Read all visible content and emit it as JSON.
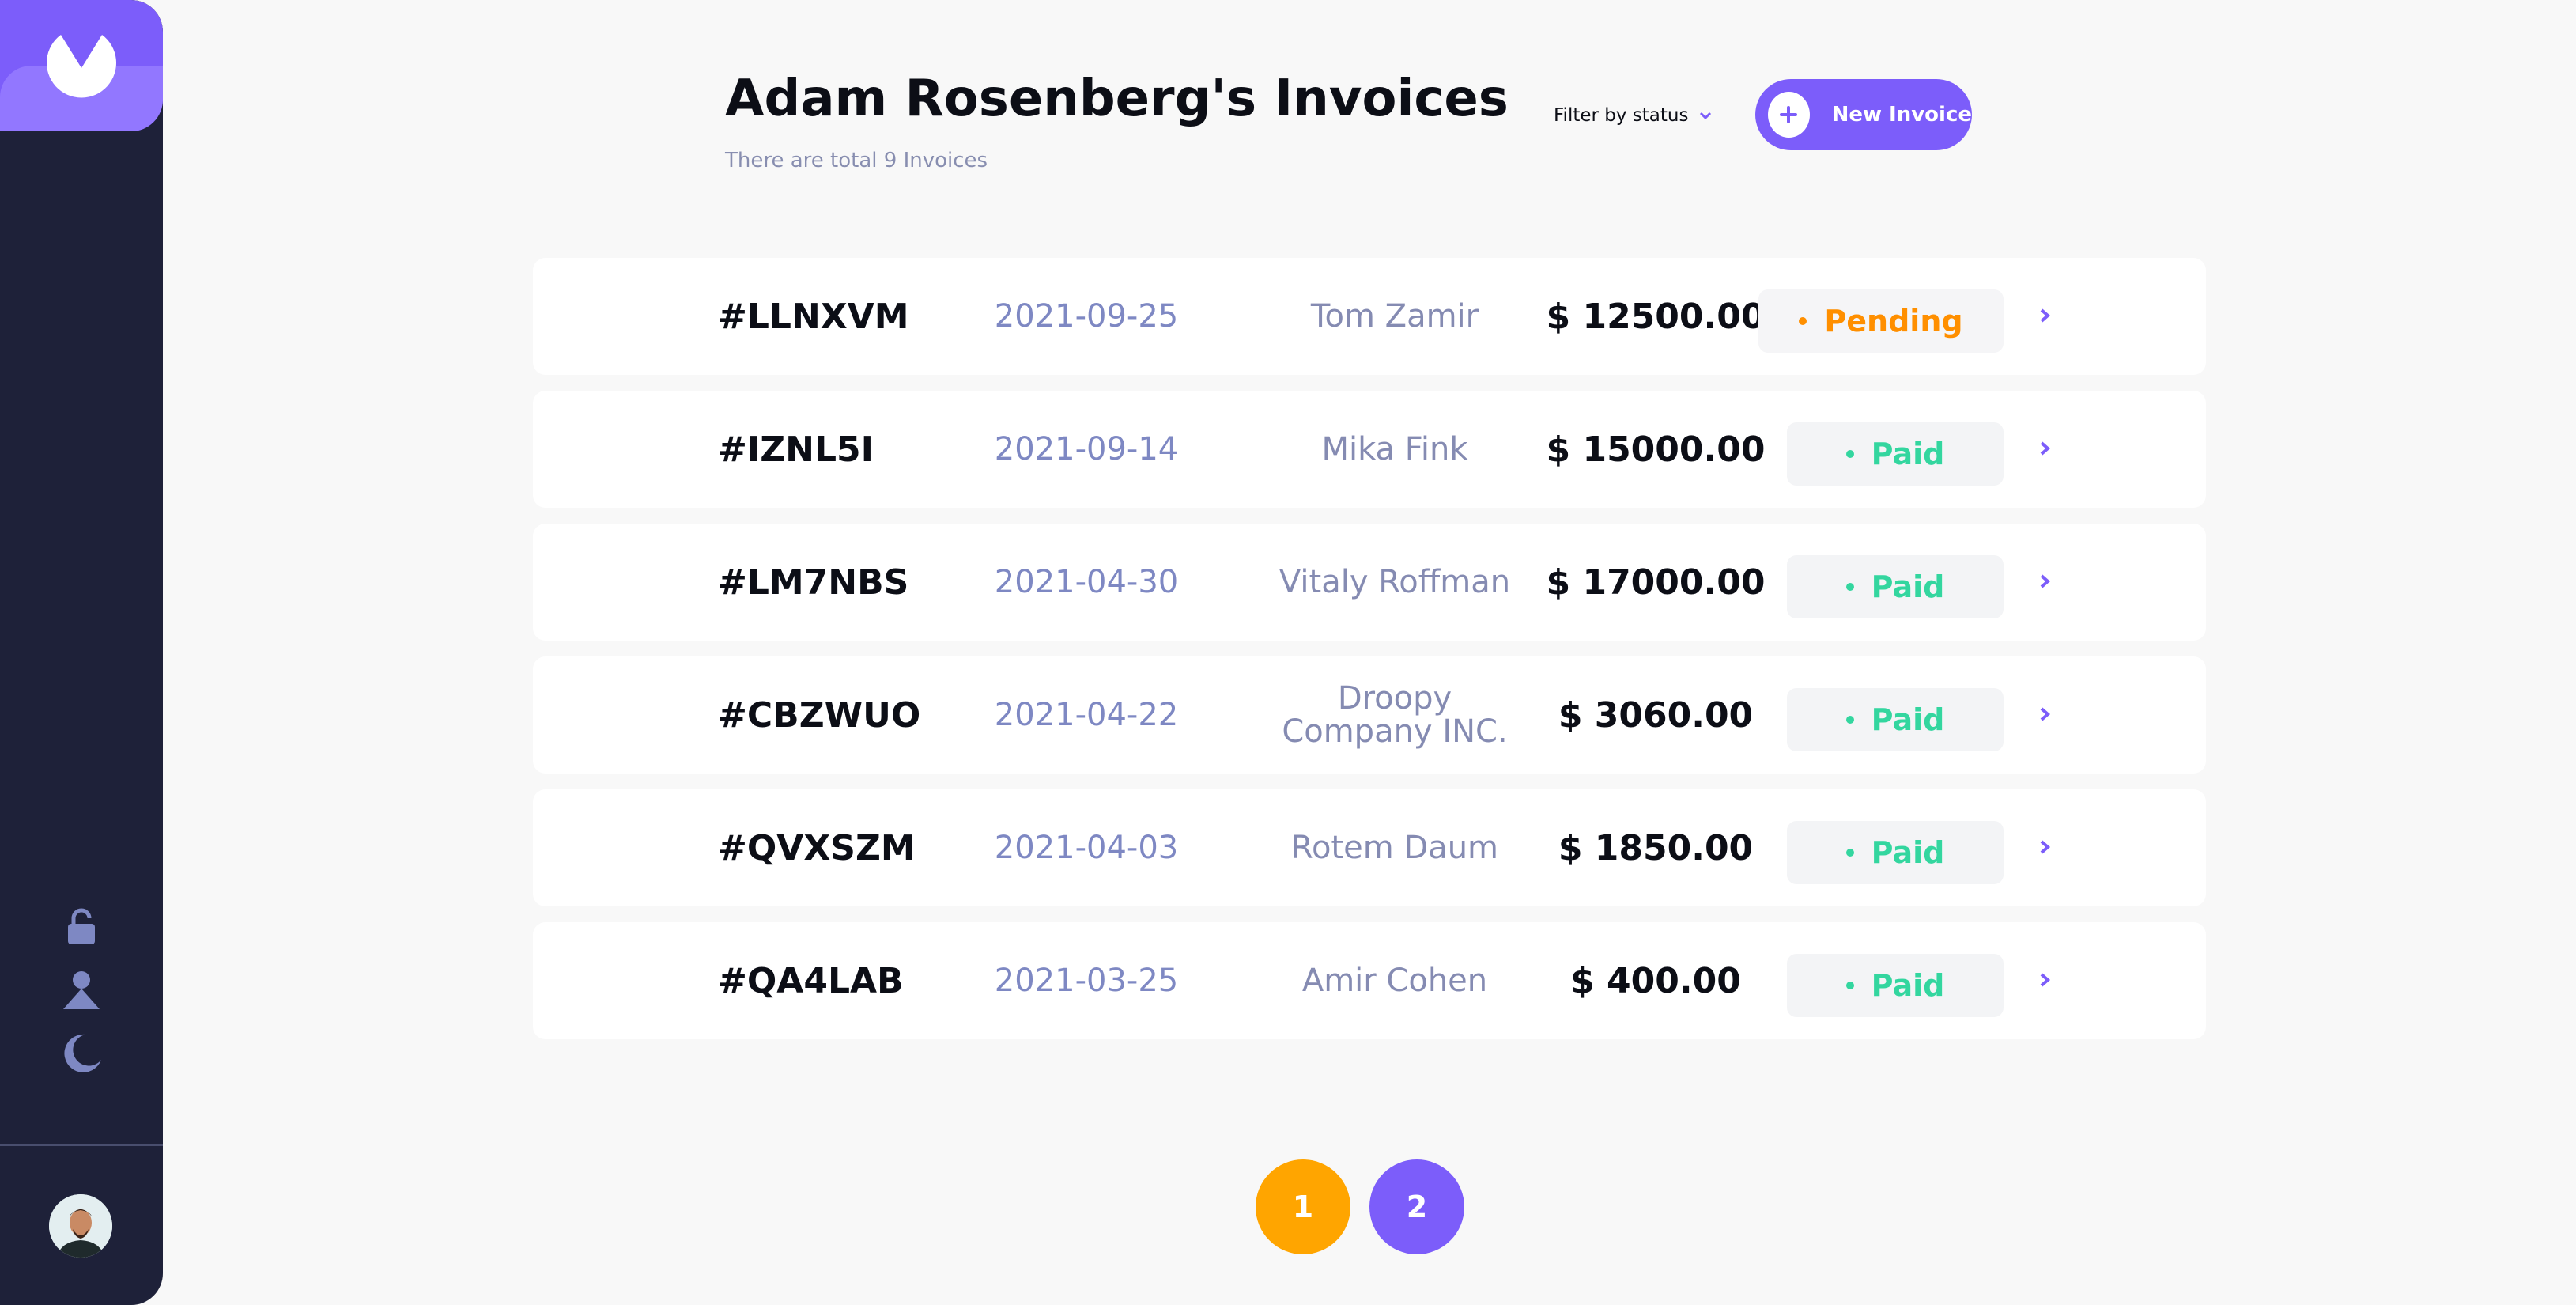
{
  "sidebar": {
    "logo_icon": "app-logo",
    "icons": [
      "lock-icon",
      "user-icon",
      "moon-icon"
    ],
    "avatar": "user-avatar"
  },
  "header": {
    "title": "Adam Rosenberg's Invoices",
    "subtitle": "There are total 9 Invoices",
    "filter_label": "Filter by status",
    "new_invoice_label": "New Invoice"
  },
  "colors": {
    "accent": "#7c5dfa",
    "sidebar_bg": "#1e2139",
    "paid": "#33d69f",
    "pending": "#ff8f00",
    "page_active": "#ffa500"
  },
  "invoices": [
    {
      "id": "#LLNXVM",
      "date": "2021-09-25",
      "client": "Tom Zamir",
      "amount": "$ 12500.00",
      "status": "Pending"
    },
    {
      "id": "#IZNL5I",
      "date": "2021-09-14",
      "client": "Mika Fink",
      "amount": "$ 15000.00",
      "status": "Paid"
    },
    {
      "id": "#LM7NBS",
      "date": "2021-04-30",
      "client": "Vitaly Roffman",
      "amount": "$ 17000.00",
      "status": "Paid"
    },
    {
      "id": "#CBZWUO",
      "date": "2021-04-22",
      "client": "Droopy Company INC.",
      "amount": "$ 3060.00",
      "status": "Paid"
    },
    {
      "id": "#QVXSZM",
      "date": "2021-04-03",
      "client": "Rotem Daum",
      "amount": "$ 1850.00",
      "status": "Paid"
    },
    {
      "id": "#QA4LAB",
      "date": "2021-03-25",
      "client": "Amir Cohen",
      "amount": "$ 400.00",
      "status": "Paid"
    }
  ],
  "pagination": {
    "pages": [
      "1",
      "2"
    ],
    "current": "1"
  }
}
